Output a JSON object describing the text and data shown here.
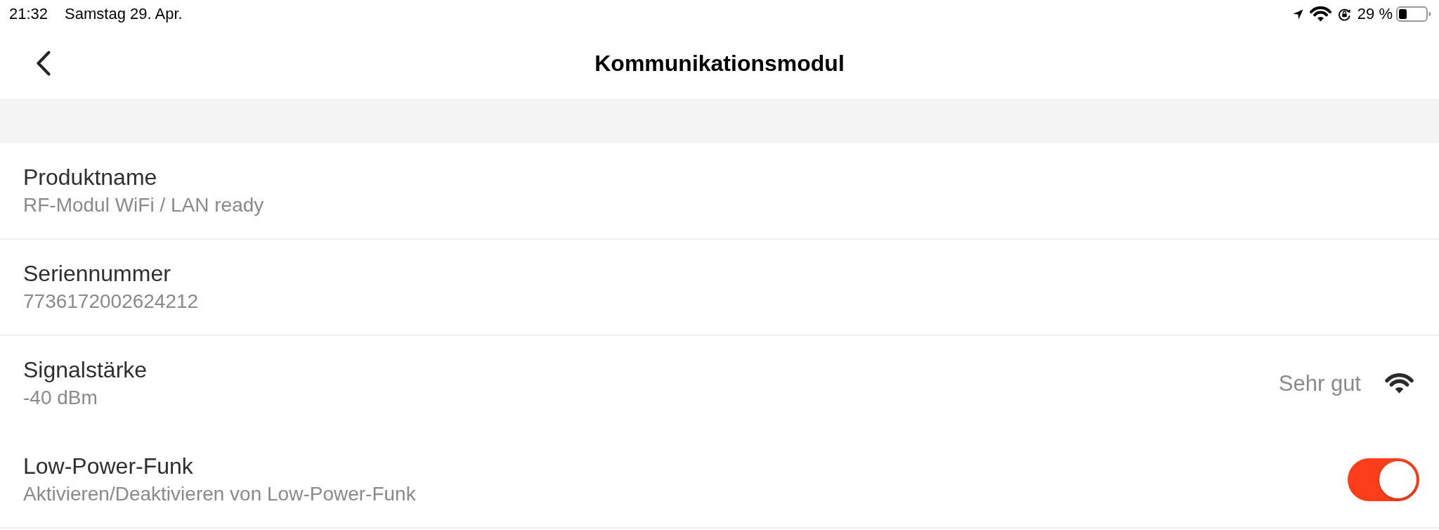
{
  "status_bar": {
    "time": "21:32",
    "date": "Samstag 29. Apr.",
    "battery_percent": "29 %"
  },
  "header": {
    "title": "Kommunikationsmodul"
  },
  "rows": [
    {
      "kind": "info",
      "title": "Produktname",
      "subtitle": "RF-Modul WiFi / LAN ready",
      "divider": true
    },
    {
      "kind": "info",
      "title": "Seriennummer",
      "subtitle": "7736172002624212",
      "divider": true
    },
    {
      "kind": "signal",
      "title": "Signalstärke",
      "subtitle": "-40 dBm",
      "value": "Sehr gut",
      "divider": false
    },
    {
      "kind": "toggle",
      "title": "Low-Power-Funk",
      "subtitle": "Aktivieren/Deaktivieren von Low-Power-Funk",
      "on": true,
      "divider": true
    }
  ]
}
